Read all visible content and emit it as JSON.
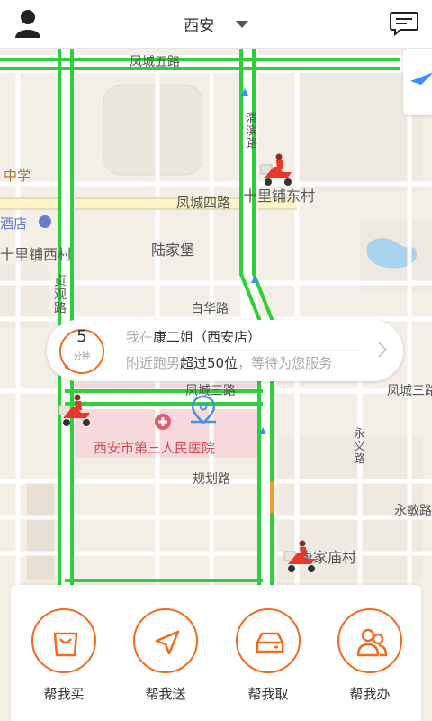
{
  "header": {
    "city": "西安"
  },
  "map": {
    "road_labels": {
      "fengcheng5": "凤城五路",
      "fengcheng4": "凤城四路",
      "fengcheng3": "凤城三路",
      "fengcheng3_east": "凤城三路",
      "baihua": "白华路",
      "guihua": "规划路",
      "zhenguan": "贞观路",
      "yongmin": "永敏路",
      "wenjing": "渭滨路",
      "yongyi": "永义路"
    },
    "poi_labels": {
      "shilipu_east": "十里铺东村",
      "shilipu_west": "十里铺西村",
      "lujiabao": "陆家堡",
      "hospital": "西安市第三人民医院",
      "kangjia": "康家庙村",
      "school": "中学",
      "hotel": "酒店"
    }
  },
  "bubble": {
    "minutes": "5",
    "unit": "分钟",
    "line1_prefix": "我在",
    "line1_store": "康二姐（西安店）",
    "line2_prefix": "附近跑男",
    "line2_highlight": "超过50位",
    "line2_suffix": "，等待为您服务"
  },
  "actions": [
    {
      "label": "帮我买",
      "icon": "shopping-bag-icon"
    },
    {
      "label": "帮我送",
      "icon": "navigation-arrow-icon"
    },
    {
      "label": "帮我取",
      "icon": "box-icon"
    },
    {
      "label": "帮我办",
      "icon": "people-icon"
    }
  ],
  "colors": {
    "accent": "#f26a1b",
    "traffic_clear": "#2fcf3c",
    "traffic_slow": "#f39c2c",
    "hospital_zone": "#f6d9dc"
  }
}
